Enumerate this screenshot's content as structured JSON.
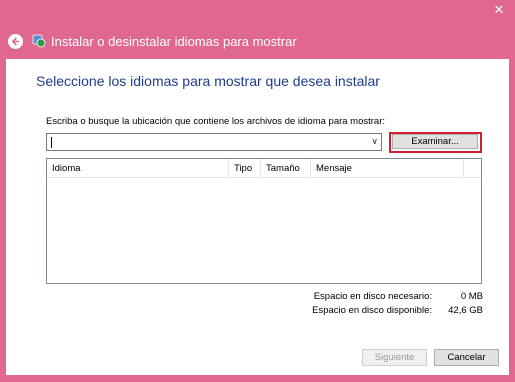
{
  "window": {
    "title": "Instalar o desinstalar idiomas para mostrar",
    "close_glyph": "✕",
    "back_icon": "back-arrow-icon",
    "app_icon": "language-globe-icon"
  },
  "main": {
    "heading": "Seleccione los idiomas para mostrar que desea instalar",
    "path_label": "Escriba o busque la ubicación que contiene los archivos de idioma para mostrar:",
    "path_value": "",
    "browse_label": "Examinar...",
    "table": {
      "columns": [
        "Idioma",
        "Tipo",
        "Tamaño",
        "Mensaje"
      ],
      "rows": []
    },
    "disk": {
      "required_label": "Espacio en disco necesario:",
      "required_value": "0 MB",
      "available_label": "Espacio en disco disponible:",
      "available_value": "42,6 GB"
    }
  },
  "footer": {
    "next_label": "Siguiente",
    "cancel_label": "Cancelar"
  },
  "colors": {
    "background": "#e0678f",
    "heading": "#1e3c8c",
    "highlight": "#d21f2b"
  }
}
